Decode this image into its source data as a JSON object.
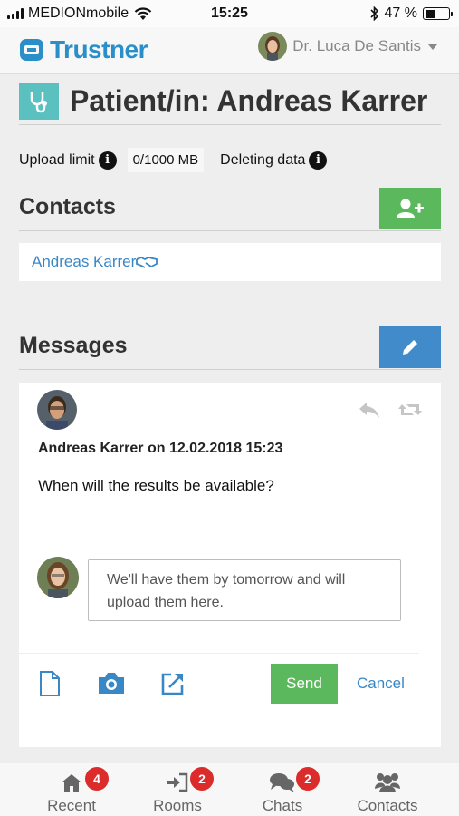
{
  "status_bar": {
    "carrier": "MEDIONmobile",
    "time": "15:25",
    "battery_text": "47 %",
    "battery_level": 0.47
  },
  "header": {
    "logo_text": "Trustner",
    "user_name": "Dr. Luca De Santis"
  },
  "page": {
    "title": "Patient/in: Andreas Karrer",
    "upload_limit_label": "Upload limit",
    "upload_limit_value": "0/1000 MB",
    "deleting_label": "Deleting data"
  },
  "contacts": {
    "heading": "Contacts",
    "items": [
      {
        "name": "Andreas Karrer"
      }
    ]
  },
  "messages": {
    "heading": "Messages",
    "message": {
      "meta": "Andreas Karrer on 12.02.2018 15:23",
      "body": "When will the results be available?"
    },
    "reply": {
      "value": "We'll have them by tomorrow and will upload them here."
    },
    "send_label": "Send",
    "cancel_label": "Cancel"
  },
  "tabs": [
    {
      "label": "Recent",
      "icon": "home-icon",
      "badge": "4"
    },
    {
      "label": "Rooms",
      "icon": "sign-in-icon",
      "badge": "2"
    },
    {
      "label": "Chats",
      "icon": "comments-icon",
      "badge": "2"
    },
    {
      "label": "Contacts",
      "icon": "users-icon",
      "badge": ""
    }
  ],
  "colors": {
    "brand_blue": "#2a8fc9",
    "success_green": "#5cb85c",
    "primary_blue": "#428bca",
    "badge_red": "#dc2b2b",
    "stethoscope_teal": "#5bc0c0"
  }
}
